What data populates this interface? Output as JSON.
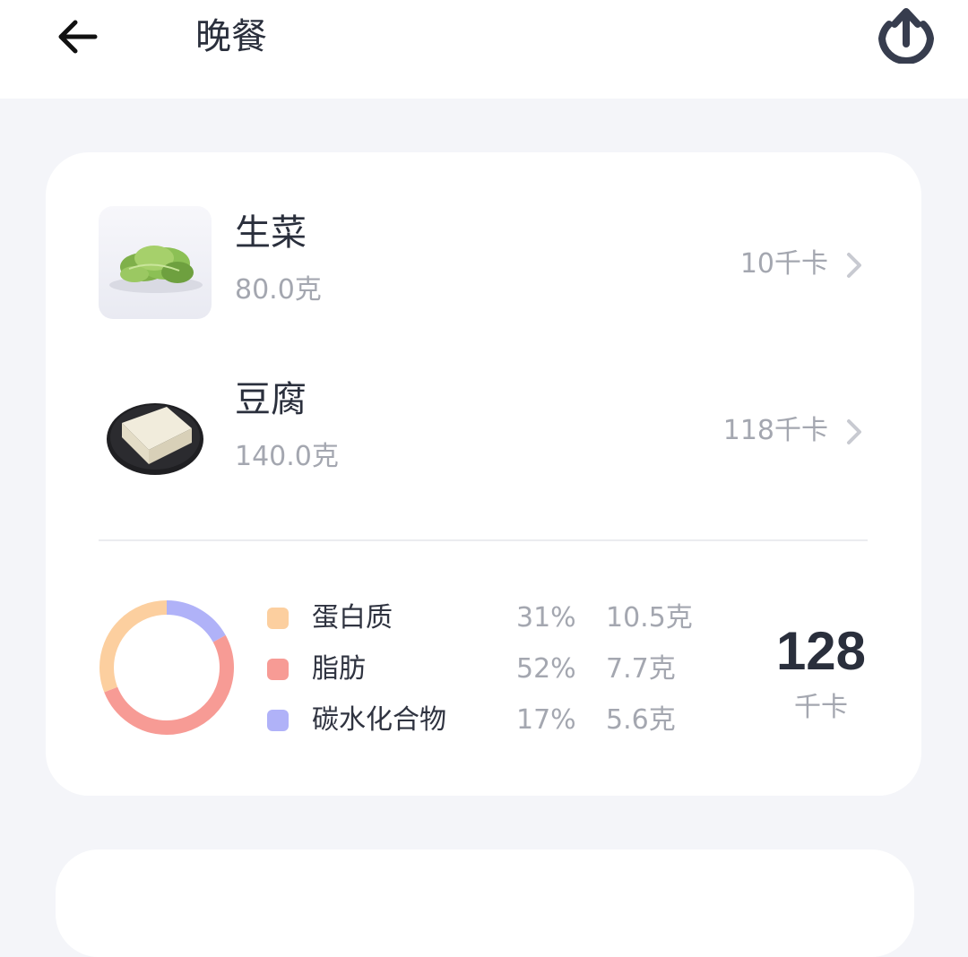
{
  "header": {
    "title": "晚餐",
    "back_icon": "arrow-left-icon",
    "share_icon": "share-upload-icon"
  },
  "foods": [
    {
      "name": "生菜",
      "weight": "80.0克",
      "calories": "10千卡",
      "image": "lettuce-photo"
    },
    {
      "name": "豆腐",
      "weight": "140.0克",
      "calories": "118千卡",
      "image": "tofu-photo"
    }
  ],
  "nutrition": {
    "items": [
      {
        "name": "蛋白质",
        "percent": "31%",
        "amount": "10.5克",
        "color": "#fccf9f"
      },
      {
        "name": "脂肪",
        "percent": "52%",
        "amount": "7.7克",
        "color": "#f79b95"
      },
      {
        "name": "碳水化合物",
        "percent": "17%",
        "amount": "5.6克",
        "color": "#b0b2f8"
      }
    ],
    "total_value": "128",
    "total_unit": "千卡"
  },
  "colors": {
    "background": "#f4f5f9",
    "card": "#ffffff",
    "text_primary": "#2a2f3c",
    "text_secondary": "#a4a7b0"
  }
}
